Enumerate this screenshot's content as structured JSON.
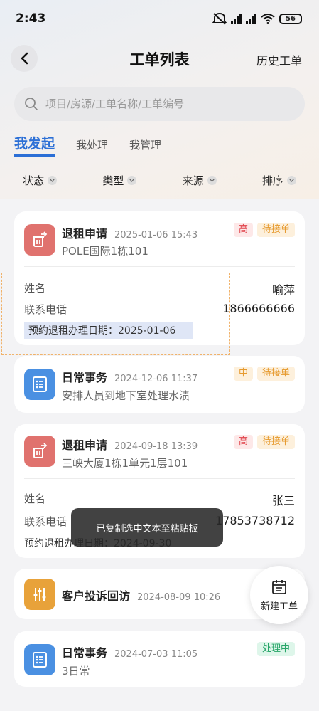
{
  "status_bar": {
    "time": "2:43",
    "battery": "56"
  },
  "header": {
    "title": "工单列表",
    "history_label": "历史工单"
  },
  "search": {
    "placeholder": "项目/房源/工单名称/工单编号"
  },
  "tabs": [
    {
      "label": "我发起",
      "active": true
    },
    {
      "label": "我处理",
      "active": false
    },
    {
      "label": "我管理",
      "active": false
    }
  ],
  "filters": [
    "状态",
    "类型",
    "来源",
    "排序"
  ],
  "colors": {
    "accent": "#2b6fd6",
    "refund_icon": "#e0726e",
    "daily_icon": "#4a90e2",
    "complaint_icon": "#e8a23a"
  },
  "orders": [
    {
      "title": "退租申请",
      "time": "2025-01-06 15:43",
      "subtitle": "POLE国际1栋101",
      "icon": "refund-icon",
      "badges": [
        "高",
        "待接单"
      ],
      "name_label": "姓名",
      "name": "喻萍",
      "phone_label": "联系电话",
      "phone": "1866666666",
      "appointment": "预约退租办理日期：2025-01-06"
    },
    {
      "title": "日常事务",
      "time": "2024-12-06 11:37",
      "subtitle": "安排人员到地下室处理水渍",
      "icon": "list-icon",
      "badges": [
        "中",
        "待接单"
      ]
    },
    {
      "title": "退租申请",
      "time": "2024-09-18 13:39",
      "subtitle": "三峡大厦1栋1单元1层101",
      "icon": "refund-icon",
      "badges": [
        "高",
        "待接单"
      ],
      "name_label": "姓名",
      "name": "张三",
      "phone_label": "联系电话",
      "phone": "17853738712",
      "appointment": "预约退租办理日期：2024-09-30"
    },
    {
      "title": "客户投诉回访",
      "time": "2024-08-09 10:26",
      "icon": "sliders-icon",
      "badges": []
    },
    {
      "title": "日常事务",
      "time": "2024-07-03 11:05",
      "subtitle": "3日常",
      "icon": "list-icon",
      "badges": [
        "处理中"
      ]
    }
  ],
  "toast": "已复制选中文本至粘贴板",
  "fab_label": "新建工单"
}
